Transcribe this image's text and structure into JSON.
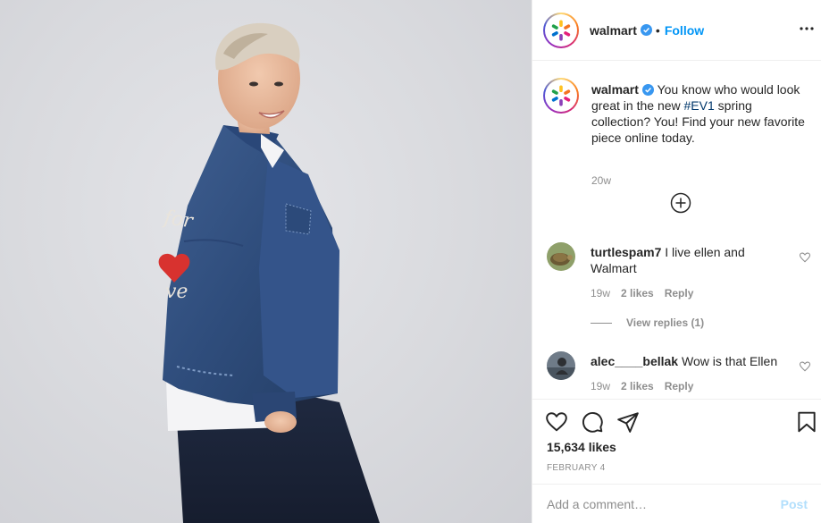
{
  "account": {
    "username": "walmart",
    "follow_label": "Follow",
    "separator": "•",
    "brand_color": "#ffc220",
    "spark_colors": [
      "#ffc220",
      "#f47321",
      "#e41f7b",
      "#8b3fb8",
      "#0071ce",
      "#21a04a"
    ]
  },
  "caption": {
    "username": "walmart",
    "text_before": "You know who would look great in the new ",
    "hashtag": "#EV1",
    "text_after": " spring collection? You! Find your new favorite piece online today.",
    "age": "20w"
  },
  "comments": [
    {
      "username": "turtlespam7",
      "text": "I live ellen and Walmart",
      "age": "19w",
      "likes": "2 likes",
      "reply_label": "Reply",
      "view_replies": "View replies (1)",
      "avatar_icon": "turtle-avatar"
    },
    {
      "username": "alec____bellak",
      "text": "Wow is that Ellen",
      "age": "19w",
      "likes": "2 likes",
      "reply_label": "Reply",
      "avatar_icon": "person-avatar"
    }
  ],
  "actions": {
    "icons": [
      "heart-icon",
      "comment-icon",
      "share-icon",
      "bookmark-icon"
    ],
    "likes_count": "15,634 likes",
    "date": "FEBRUARY 4"
  },
  "composer": {
    "placeholder": "Add a comment…",
    "post_label": "Post"
  },
  "photo": {
    "jacket_text": [
      "for",
      "ve"
    ]
  }
}
